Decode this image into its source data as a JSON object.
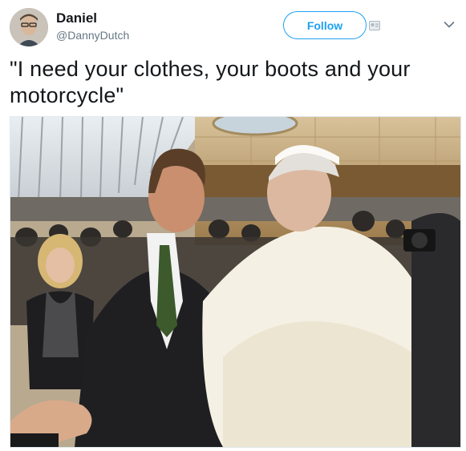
{
  "tweet": {
    "author_name": "Daniel",
    "author_handle": "@DannyDutch",
    "follow_label": "Follow",
    "text": "\"I need your clothes, your boots and your motorcycle\""
  },
  "icons": {
    "menu": "chevron-down-icon",
    "follow_extra": "user-card-icon"
  },
  "colors": {
    "accent": "#1da1f2",
    "secondary_text": "#657786",
    "primary_text": "#14171a"
  }
}
